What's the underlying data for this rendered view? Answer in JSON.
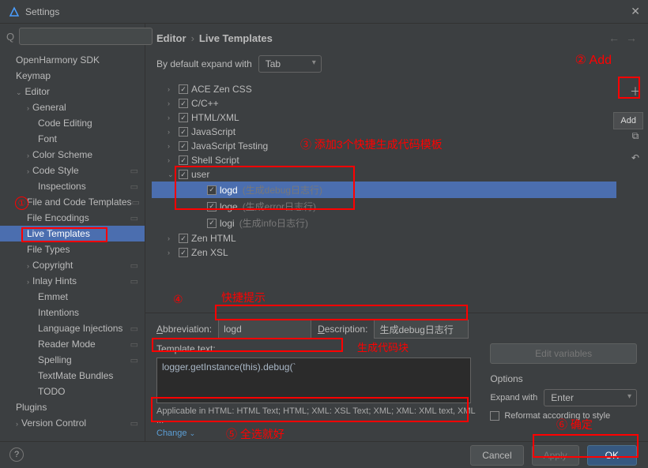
{
  "titlebar": {
    "title": "Settings"
  },
  "sidebar": {
    "items": [
      {
        "label": "OpenHarmony SDK",
        "level": 1
      },
      {
        "label": "Keymap",
        "level": 1
      },
      {
        "label": "Editor",
        "level": 1,
        "expanded": true
      },
      {
        "label": "General",
        "level": 2,
        "expandable": true
      },
      {
        "label": "Code Editing",
        "level": 3
      },
      {
        "label": "Font",
        "level": 3
      },
      {
        "label": "Color Scheme",
        "level": 2,
        "expandable": true
      },
      {
        "label": "Code Style",
        "level": 2,
        "expandable": true,
        "icon": true
      },
      {
        "label": "Inspections",
        "level": 3,
        "icon": true
      },
      {
        "label": "File and Code Templates",
        "level": 2,
        "icon": true
      },
      {
        "label": "File Encodings",
        "level": 2,
        "icon": true
      },
      {
        "label": "Live Templates",
        "level": 2,
        "selected": true
      },
      {
        "label": "File Types",
        "level": 2
      },
      {
        "label": "Copyright",
        "level": 2,
        "expandable": true,
        "icon": true
      },
      {
        "label": "Inlay Hints",
        "level": 2,
        "expandable": true,
        "icon": true
      },
      {
        "label": "Emmet",
        "level": 3
      },
      {
        "label": "Intentions",
        "level": 3
      },
      {
        "label": "Language Injections",
        "level": 3,
        "icon": true
      },
      {
        "label": "Reader Mode",
        "level": 3,
        "icon": true
      },
      {
        "label": "Spelling",
        "level": 3,
        "icon": true
      },
      {
        "label": "TextMate Bundles",
        "level": 3
      },
      {
        "label": "TODO",
        "level": 3
      },
      {
        "label": "Plugins",
        "level": 1
      },
      {
        "label": "Version Control",
        "level": 1,
        "expandable": true,
        "icon": true
      }
    ]
  },
  "breadcrumb": {
    "parent": "Editor",
    "current": "Live Templates"
  },
  "expand": {
    "label": "By default expand with",
    "value": "Tab"
  },
  "templates": [
    {
      "label": "ACE Zen CSS",
      "level": 1,
      "expandable": true,
      "checked": true
    },
    {
      "label": "C/C++",
      "level": 1,
      "expandable": true,
      "checked": true
    },
    {
      "label": "HTML/XML",
      "level": 1,
      "expandable": true,
      "checked": true
    },
    {
      "label": "JavaScript",
      "level": 1,
      "expandable": true,
      "checked": true
    },
    {
      "label": "JavaScript Testing",
      "level": 1,
      "expandable": true,
      "checked": true
    },
    {
      "label": "Shell Script",
      "level": 1,
      "expandable": true,
      "checked": true
    },
    {
      "label": "user",
      "level": 1,
      "expandable": true,
      "expanded": true,
      "checked": true
    },
    {
      "label": "logd",
      "desc": "(生成debug日志行)",
      "level": 2,
      "checked": true,
      "selected": true
    },
    {
      "label": "loge",
      "desc": "(生成error日志行)",
      "level": 2,
      "checked": true
    },
    {
      "label": "logi",
      "desc": "(生成info日志行)",
      "level": 2,
      "checked": true
    },
    {
      "label": "Zen HTML",
      "level": 1,
      "expandable": true,
      "checked": true
    },
    {
      "label": "Zen XSL",
      "level": 1,
      "expandable": true,
      "checked": true
    }
  ],
  "form": {
    "abbr_label": "Abbreviation:",
    "abbr_value": "logd",
    "desc_label": "Description:",
    "desc_value": "生成debug日志行",
    "text_label": "Template text:",
    "text_value": "logger.getInstance(this).debug(`",
    "edit_vars": "Edit variables",
    "options_label": "Options",
    "expand_label": "Expand with",
    "expand_value": "Enter",
    "reformat_label": "Reformat according to style",
    "applicable": "Applicable in HTML: HTML Text; HTML; XML: XSL Text; XML; XML: XML text, XML ...",
    "change": "Change"
  },
  "buttons": {
    "cancel": "Cancel",
    "apply": "Apply",
    "ok": "OK"
  },
  "tooltip": "Add",
  "annotations": {
    "a2": "② Add",
    "a3": "③  添加3个快捷生成代码模板",
    "a4_num": "④",
    "a4_text": "快捷提示",
    "a5": "⑤  全选就好",
    "a5_code": "生成代码块",
    "a6": "⑥  确定"
  }
}
